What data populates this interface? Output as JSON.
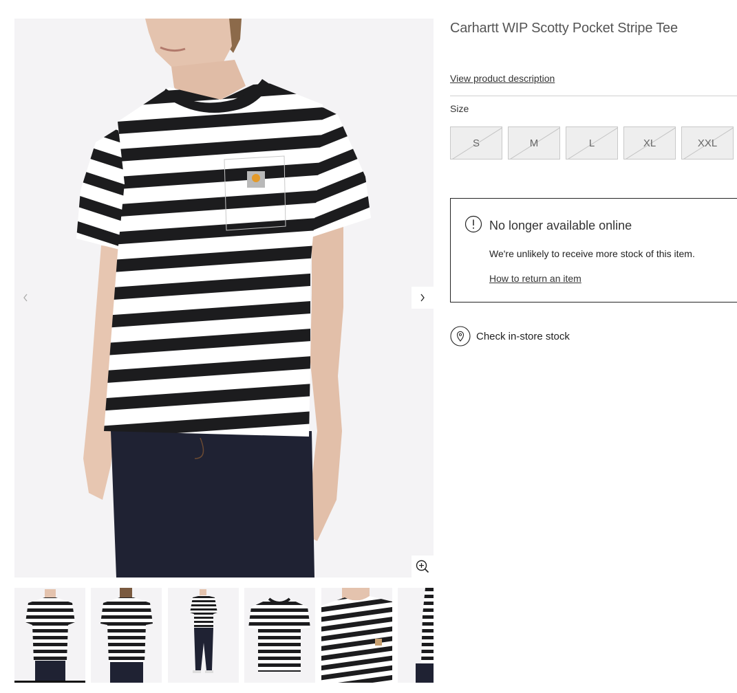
{
  "product": {
    "title": "Carhartt WIP Scotty Pocket Stripe Tee",
    "view_description_link": "View product description"
  },
  "size_selector": {
    "label": "Size",
    "options": [
      {
        "label": "S",
        "available": false
      },
      {
        "label": "M",
        "available": false
      },
      {
        "label": "L",
        "available": false
      },
      {
        "label": "XL",
        "available": false
      },
      {
        "label": "XXL",
        "available": false
      }
    ]
  },
  "availability_notice": {
    "icon": "exclamation-circle-icon",
    "title": "No longer available online",
    "body": "We're unlikely to receive more stock of this item.",
    "link": "How to return an item"
  },
  "store_stock": {
    "icon": "location-pin-icon",
    "label": "Check in-store stock"
  },
  "gallery": {
    "prev_icon": "chevron-left-icon",
    "next_icon": "chevron-right-icon",
    "zoom_icon": "zoom-in-icon",
    "thumbnail_count": 6,
    "active_thumbnail": 1
  },
  "colors": {
    "stripe_dark": "#1c1c1e",
    "stripe_light": "#ffffff",
    "background": "#f4f3f5",
    "denim": "#1f2233",
    "skin": "#e8c8b4"
  }
}
